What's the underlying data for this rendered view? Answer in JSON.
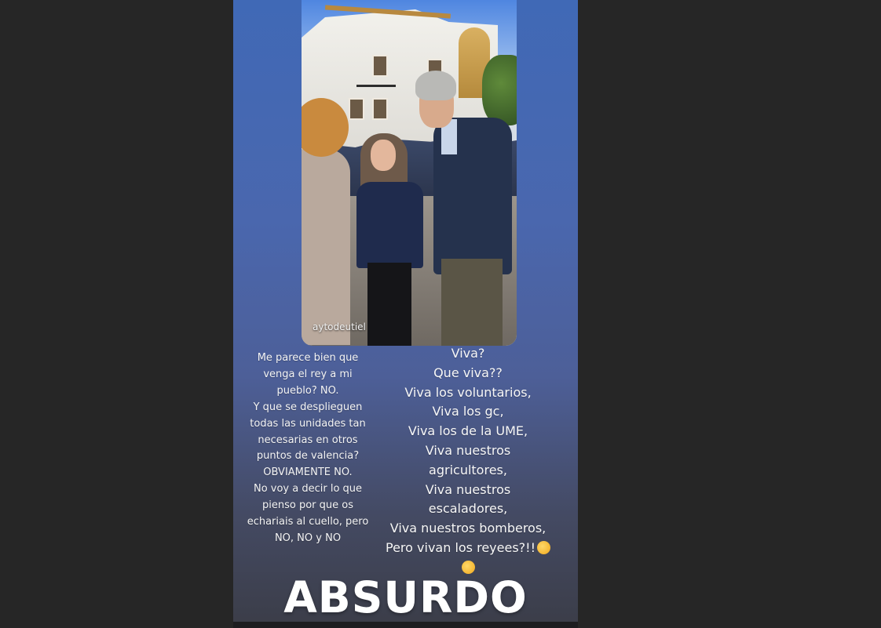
{
  "photo": {
    "watermark": "aytodeutiel"
  },
  "left_text": {
    "lines": [
      "Me parece bien que",
      "venga el rey a mi",
      "pueblo? NO.",
      "Y que se desplieguen",
      "todas las unidades tan",
      "necesarias en otros",
      "puntos de valencia?",
      "OBVIAMENTE NO.",
      "No voy a decir lo que",
      "pienso por que os",
      "echariais al cuello, pero",
      "NO, NO y NO"
    ]
  },
  "right_text": {
    "lines": [
      "Viva?",
      "Que viva??",
      "Viva los voluntarios,",
      "Viva los gc,",
      "Viva los de la UME,",
      "Viva nuestros",
      "agricultores,",
      "Viva nuestros",
      "escaladores,",
      "Viva nuestros bomberos,",
      "Pero vivan los reyees?!!"
    ],
    "emoji_1": "laughing-tears-emoji",
    "emoji_2": "crazy-face-emoji"
  },
  "sticker": {
    "text": "ABSURDO"
  },
  "colors": {
    "page_background": "#262626",
    "story_gradient_top": "#4069b6",
    "story_gradient_bottom": "#3b3d48",
    "text": "#f4f4f4"
  }
}
